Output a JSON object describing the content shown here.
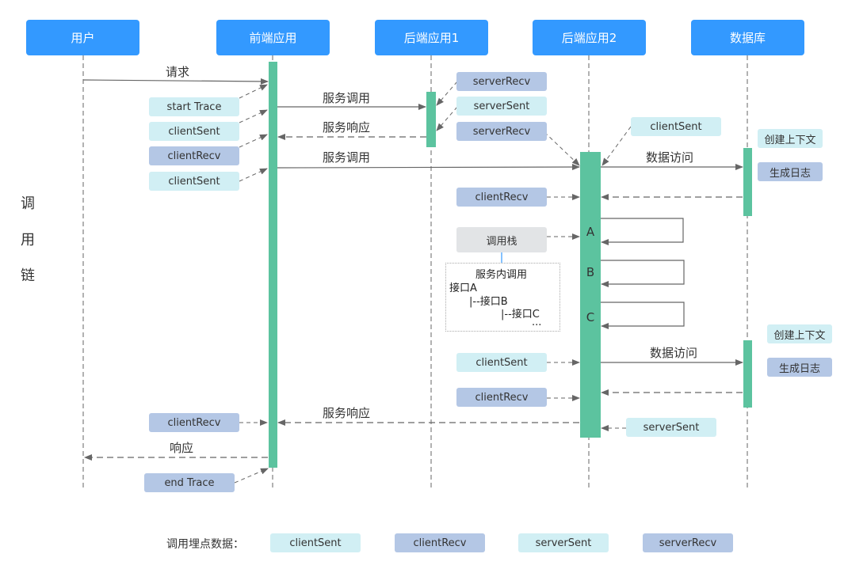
{
  "title_side": [
    "调",
    "用",
    "链"
  ],
  "lanes": [
    {
      "id": "user",
      "label": "用户"
    },
    {
      "id": "frontend",
      "label": "前端应用"
    },
    {
      "id": "backend1",
      "label": "后端应用1"
    },
    {
      "id": "backend2",
      "label": "后端应用2"
    },
    {
      "id": "database",
      "label": "数据库"
    }
  ],
  "messages": {
    "request": "请求",
    "service_call_1": "服务调用",
    "service_response_1": "服务响应",
    "service_call_2": "服务调用",
    "data_access_1": "数据访问",
    "data_access_2": "数据访问",
    "service_response_2": "服务响应",
    "response": "响应"
  },
  "tags": {
    "fe_start_trace": "start Trace",
    "fe_client_sent_1": "clientSent",
    "fe_client_recv_1": "clientRecv",
    "fe_client_sent_2": "clientSent",
    "fe_client_recv_2": "clientRecv",
    "fe_end_trace": "end Trace",
    "b1_server_recv": "serverRecv",
    "b1_server_sent": "serverSent",
    "b2_server_recv": "serverRecv",
    "b2_client_sent_1": "clientSent",
    "b2_client_recv_1": "clientRecv",
    "b2_call_stack": "调用栈",
    "b2_client_sent_2": "clientSent",
    "b2_client_recv_2": "clientRecv",
    "b2_server_sent": "serverSent",
    "db_create_context_1": "创建上下文",
    "db_gen_log_1": "生成日志",
    "db_create_context_2": "创建上下文",
    "db_gen_log_2": "生成日志"
  },
  "activation_letters": [
    "A",
    "B",
    "C"
  ],
  "call_stack_note": {
    "title": "服务内调用",
    "lines": [
      "接口A",
      "|--接口B",
      "|--接口C",
      "..."
    ]
  },
  "legend": {
    "label": "调用埋点数据：",
    "items": [
      {
        "label": "clientSent",
        "kind": "light"
      },
      {
        "label": "clientRecv",
        "kind": "dark"
      },
      {
        "label": "serverSent",
        "kind": "light"
      },
      {
        "label": "serverRecv",
        "kind": "dark"
      }
    ]
  },
  "colors": {
    "lane_header": "#3399ff",
    "activation": "#5cc39f",
    "tag_light": "#d1eff4",
    "tag_dark": "#b4c7e5",
    "tag_gray": "#e2e4e6",
    "line": "#666666"
  }
}
